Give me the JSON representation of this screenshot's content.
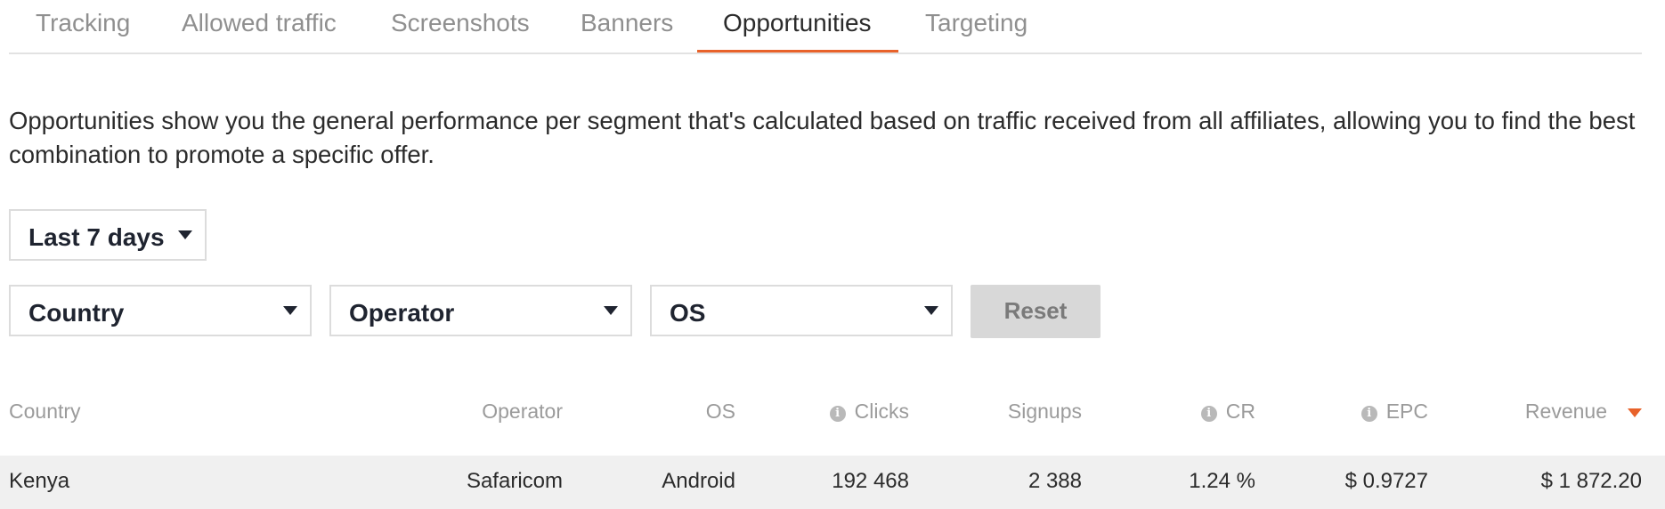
{
  "tabs": [
    {
      "label": "Tracking"
    },
    {
      "label": "Allowed traffic"
    },
    {
      "label": "Screenshots"
    },
    {
      "label": "Banners"
    },
    {
      "label": "Opportunities"
    },
    {
      "label": "Targeting"
    }
  ],
  "active_tab": "Opportunities",
  "accent_color": "#e8622a",
  "description": "Opportunities show you the general performance per segment that's calculated based on traffic received from all affiliates, allowing you to find the best combination to promote a specific offer.",
  "filters": {
    "period": "Last 7 days",
    "country": "Country",
    "operator": "Operator",
    "os": "OS",
    "reset_label": "Reset"
  },
  "table": {
    "headers": {
      "country": "Country",
      "operator": "Operator",
      "os": "OS",
      "clicks": "Clicks",
      "signups": "Signups",
      "cr": "CR",
      "epc": "EPC",
      "revenue": "Revenue"
    },
    "sorted_by": "revenue",
    "sort_direction": "desc",
    "rows": [
      {
        "country": "Kenya",
        "operator": "Safaricom",
        "os": "Android",
        "clicks": "192 468",
        "signups": "2 388",
        "cr": "1.24 %",
        "epc": "$ 0.9727",
        "revenue": "$ 1 872.20"
      }
    ]
  }
}
